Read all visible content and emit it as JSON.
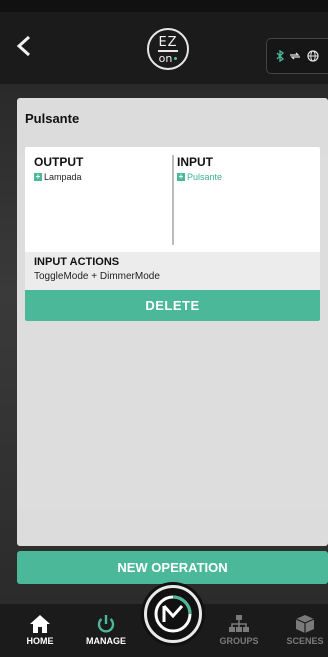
{
  "header": {
    "back_icon": "chevron-left-icon",
    "logo_top": "EZ",
    "logo_bottom": "on",
    "connection_icons": [
      "bluetooth-icon",
      "sync-arrows-icon",
      "globe-icon"
    ]
  },
  "operation": {
    "title": "Pulsante",
    "output_label": "OUTPUT",
    "output_item": "Lampada",
    "input_label": "INPUT",
    "input_item": "Pulsante",
    "input_actions_label": "INPUT ACTIONS",
    "input_actions_value": "ToggleMode + DimmerMode",
    "delete_label": "DELETE"
  },
  "new_operation_label": "NEW OPERATION",
  "bottom_nav": {
    "home": "HOME",
    "manage": "MANAGE",
    "groups": "GROUPS",
    "scenes": "SCENES"
  },
  "colors": {
    "accent": "#4cb89a",
    "background": "#1b1b1b",
    "panel": "#e8e8e8"
  }
}
